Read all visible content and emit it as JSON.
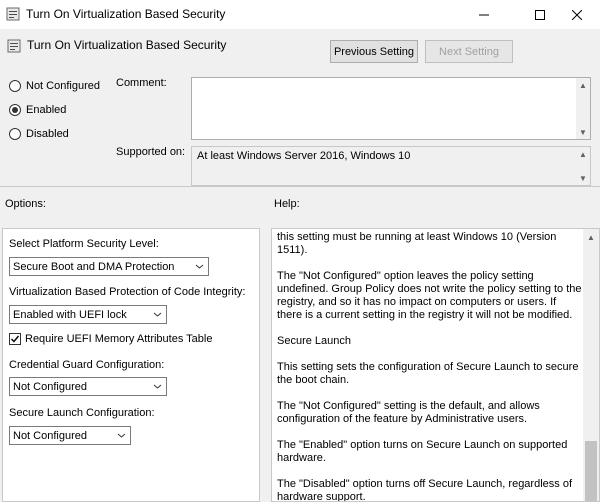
{
  "window": {
    "title": "Turn On Virtualization Based Security",
    "minimize_icon": "minimize-icon",
    "maximize_icon": "maximize-icon",
    "close_icon": "close-icon"
  },
  "header": {
    "policy_name": "Turn On Virtualization Based Security",
    "prev_label": "Previous Setting",
    "next_label": "Next Setting"
  },
  "state": {
    "options": [
      {
        "label": "Not Configured",
        "checked": false
      },
      {
        "label": "Enabled",
        "checked": true
      },
      {
        "label": "Disabled",
        "checked": false
      }
    ]
  },
  "comment": {
    "label": "Comment:",
    "value": ""
  },
  "supported": {
    "label": "Supported on:",
    "value": "At least Windows Server 2016, Windows 10"
  },
  "sections": {
    "options_label": "Options:",
    "help_label": "Help:"
  },
  "options": {
    "platform_label": "Select Platform Security Level:",
    "platform_value": "Secure Boot and DMA Protection",
    "ci_label": "Virtualization Based Protection of Code Integrity:",
    "ci_value": "Enabled with UEFI lock",
    "uefi_label": "Require UEFI Memory Attributes Table",
    "uefi_checked": true,
    "cg_label": "Credential Guard Configuration:",
    "cg_value": "Not Configured",
    "sl_label": "Secure Launch Configuration:",
    "sl_value": "Not Configured"
  },
  "help": {
    "paragraphs": [
      "this setting must be running at least Windows 10 (Version 1511).",
      "The \"Not Configured\" option leaves the policy setting undefined. Group Policy does not write the policy setting to the registry, and so it has no impact on computers or users. If there is a current setting in the registry it will not be modified.",
      "Secure Launch",
      "This setting sets the configuration of Secure Launch to secure the boot chain.",
      "The \"Not Configured\" setting is the default, and allows configuration of the feature by Administrative users.",
      "The \"Enabled\" option turns on Secure Launch on supported hardware.",
      "The \"Disabled\" option turns off Secure Launch, regardless of hardware support."
    ]
  }
}
